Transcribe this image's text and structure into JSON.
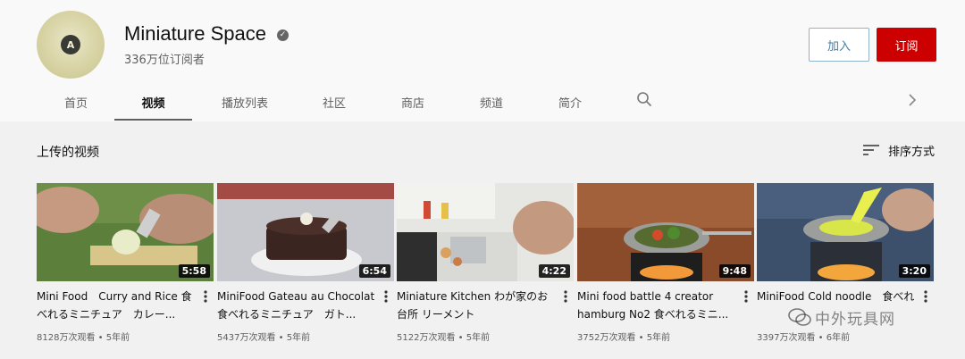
{
  "channel": {
    "name": "Miniature Space",
    "subscribers": "336万位订阅者",
    "avatar_icon": "avatar-logo-icon",
    "verified_icon": "verified-check-icon"
  },
  "actions": {
    "join_label": "加入",
    "subscribe_label": "订阅"
  },
  "tabs": [
    {
      "label": "首页"
    },
    {
      "label": "视频",
      "active": true
    },
    {
      "label": "播放列表"
    },
    {
      "label": "社区"
    },
    {
      "label": "商店"
    },
    {
      "label": "频道"
    },
    {
      "label": "简介"
    }
  ],
  "section": {
    "title": "上传的视频",
    "sort_label": "排序方式"
  },
  "videos": [
    {
      "title": "Mini Food　Curry and Rice 食べれるミニチュア　カレー...",
      "duration": "5:58",
      "meta": "8128万次观看 • 5年前"
    },
    {
      "title": "MiniFood Gateau au Chocolat 食べれるミニチュア　ガト...",
      "duration": "6:54",
      "meta": "5437万次观看 • 5年前"
    },
    {
      "title": "Miniature Kitchen わが家のお台所 リーメント",
      "duration": "4:22",
      "meta": "5122万次观看 • 5年前"
    },
    {
      "title": "Mini food battle 4 creator hamburg No2 食べれるミニ...",
      "duration": "9:48",
      "meta": "3752万次观看 • 5年前"
    },
    {
      "title": "MiniFood Cold noodle　食べれ",
      "duration": "3:20",
      "meta": "3397万次观看 • 6年前"
    }
  ],
  "watermark": {
    "text": "中外玩具网"
  },
  "colors": {
    "subscribe": "#cc0000",
    "join_border": "#8fb3c8",
    "join_text": "#3f7fa6"
  }
}
